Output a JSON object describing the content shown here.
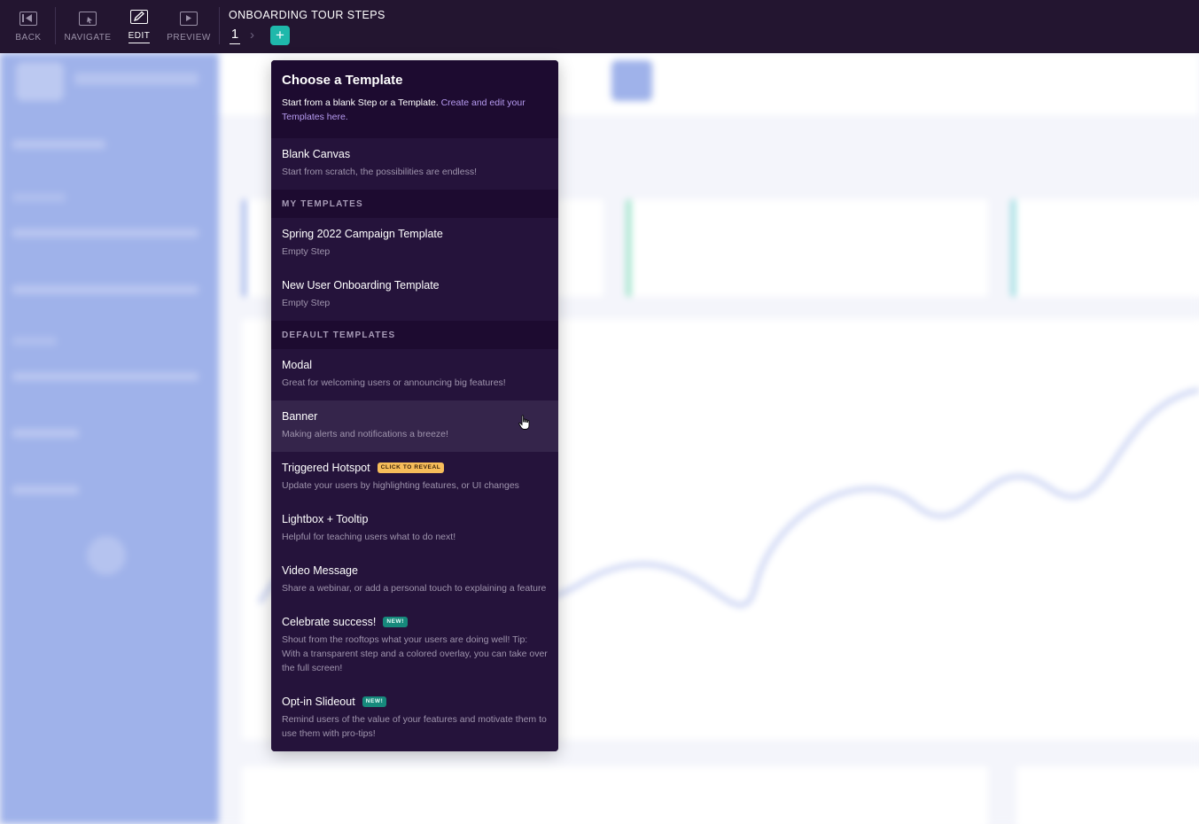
{
  "toolbar": {
    "back": "BACK",
    "navigate": "NAVIGATE",
    "edit": "EDIT",
    "preview": "PREVIEW",
    "tour_title": "ONBOARDING TOUR STEPS",
    "step_number": "1",
    "add_step": "+"
  },
  "menu": {
    "title": "Choose a Template",
    "subtitle_text": "Start from a blank Step or a Template. ",
    "subtitle_link": "Create and edit your Templates here.",
    "blank": {
      "title": "Blank Canvas",
      "desc": "Start from scratch, the possibilities are endless!"
    },
    "my_templates_header": "MY TEMPLATES",
    "my_templates": [
      {
        "title": "Spring 2022 Campaign Template",
        "desc": "Empty Step"
      },
      {
        "title": "New User Onboarding Template",
        "desc": "Empty Step"
      }
    ],
    "default_templates_header": "DEFAULT TEMPLATES",
    "default_templates": [
      {
        "title": "Modal",
        "desc": "Great for welcoming users or announcing big features!"
      },
      {
        "title": "Banner",
        "desc": "Making alerts and notifications a breeze!"
      },
      {
        "title": "Triggered Hotspot",
        "badge": "CLICK TO REVEAL",
        "desc": "Update your users by highlighting features, or UI changes"
      },
      {
        "title": "Lightbox + Tooltip",
        "desc": "Helpful for teaching users what to do next!"
      },
      {
        "title": "Video Message",
        "desc": "Share a webinar, or add a personal touch to explaining a feature"
      },
      {
        "title": "Celebrate success!",
        "badge": "NEW!",
        "desc": "Shout from the rooftops what your users are doing well! Tip: With a transparent step and a colored overlay, you can take over the full screen!"
      },
      {
        "title": "Opt-in Slideout",
        "badge": "NEW!",
        "desc": "Remind users of the value of your features and motivate them to use them with pro-tips!"
      }
    ]
  },
  "colors": {
    "toolbar_bg": "#231530",
    "menu_bg": "#23103a",
    "accent_teal": "#1fb8ab",
    "link_purple": "#b69bf0",
    "badge_orange": "#f7bd5a",
    "badge_teal": "#16897c",
    "sidebar_blue": "#9fb2ea"
  },
  "icons": {
    "back": "back-icon",
    "navigate": "navigate-icon",
    "edit": "edit-icon",
    "preview": "preview-icon",
    "cursor": "hand-pointer-icon"
  }
}
